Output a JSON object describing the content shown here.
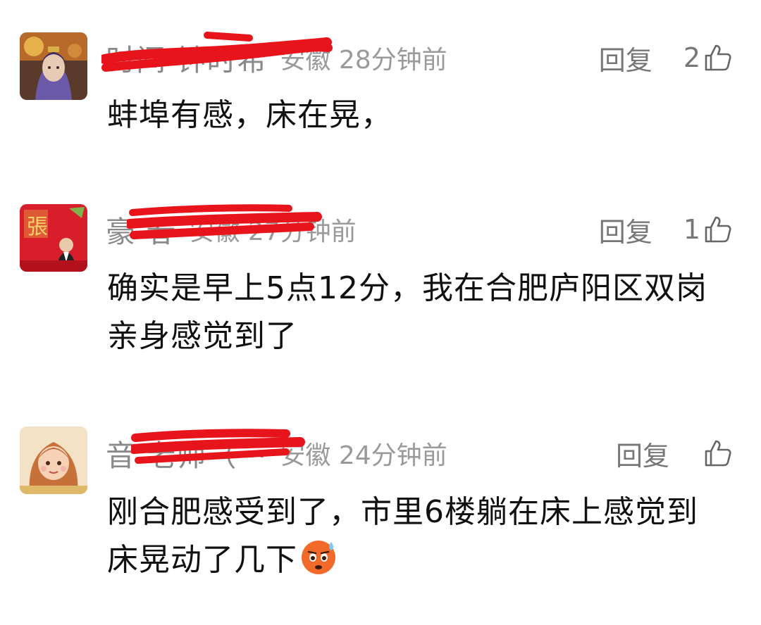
{
  "comments": [
    {
      "username_visible": "时间  钟时希",
      "location": "安徽",
      "time": "28分钟前",
      "reply_label": "回复",
      "likes": "2",
      "text": "蚌埠有感，床在晃，",
      "avatar_icon": "avatar-fantasy-character"
    },
    {
      "username_visible": "豪      春",
      "location": "安徽",
      "time": "27分钟前",
      "reply_label": "回复",
      "likes": "1",
      "text": "确实是早上5点12分，我在合肥庐阳区双岗亲身感觉到了",
      "avatar_icon": "avatar-zhang-red"
    },
    {
      "username_visible": "音    老师（···",
      "location": "安徽",
      "time": "24分钟前",
      "reply_label": "回复",
      "likes": "",
      "text": "刚合肥感受到了，市里6楼躺在床上感觉到床晃动了几下",
      "avatar_icon": "avatar-cartoon-girl",
      "emoji_icon": "anxious-sweat-face-emoji"
    }
  ],
  "colors": {
    "redaction": "#e8141b",
    "meta_text": "#9a9a9a",
    "body_text": "#111111"
  }
}
